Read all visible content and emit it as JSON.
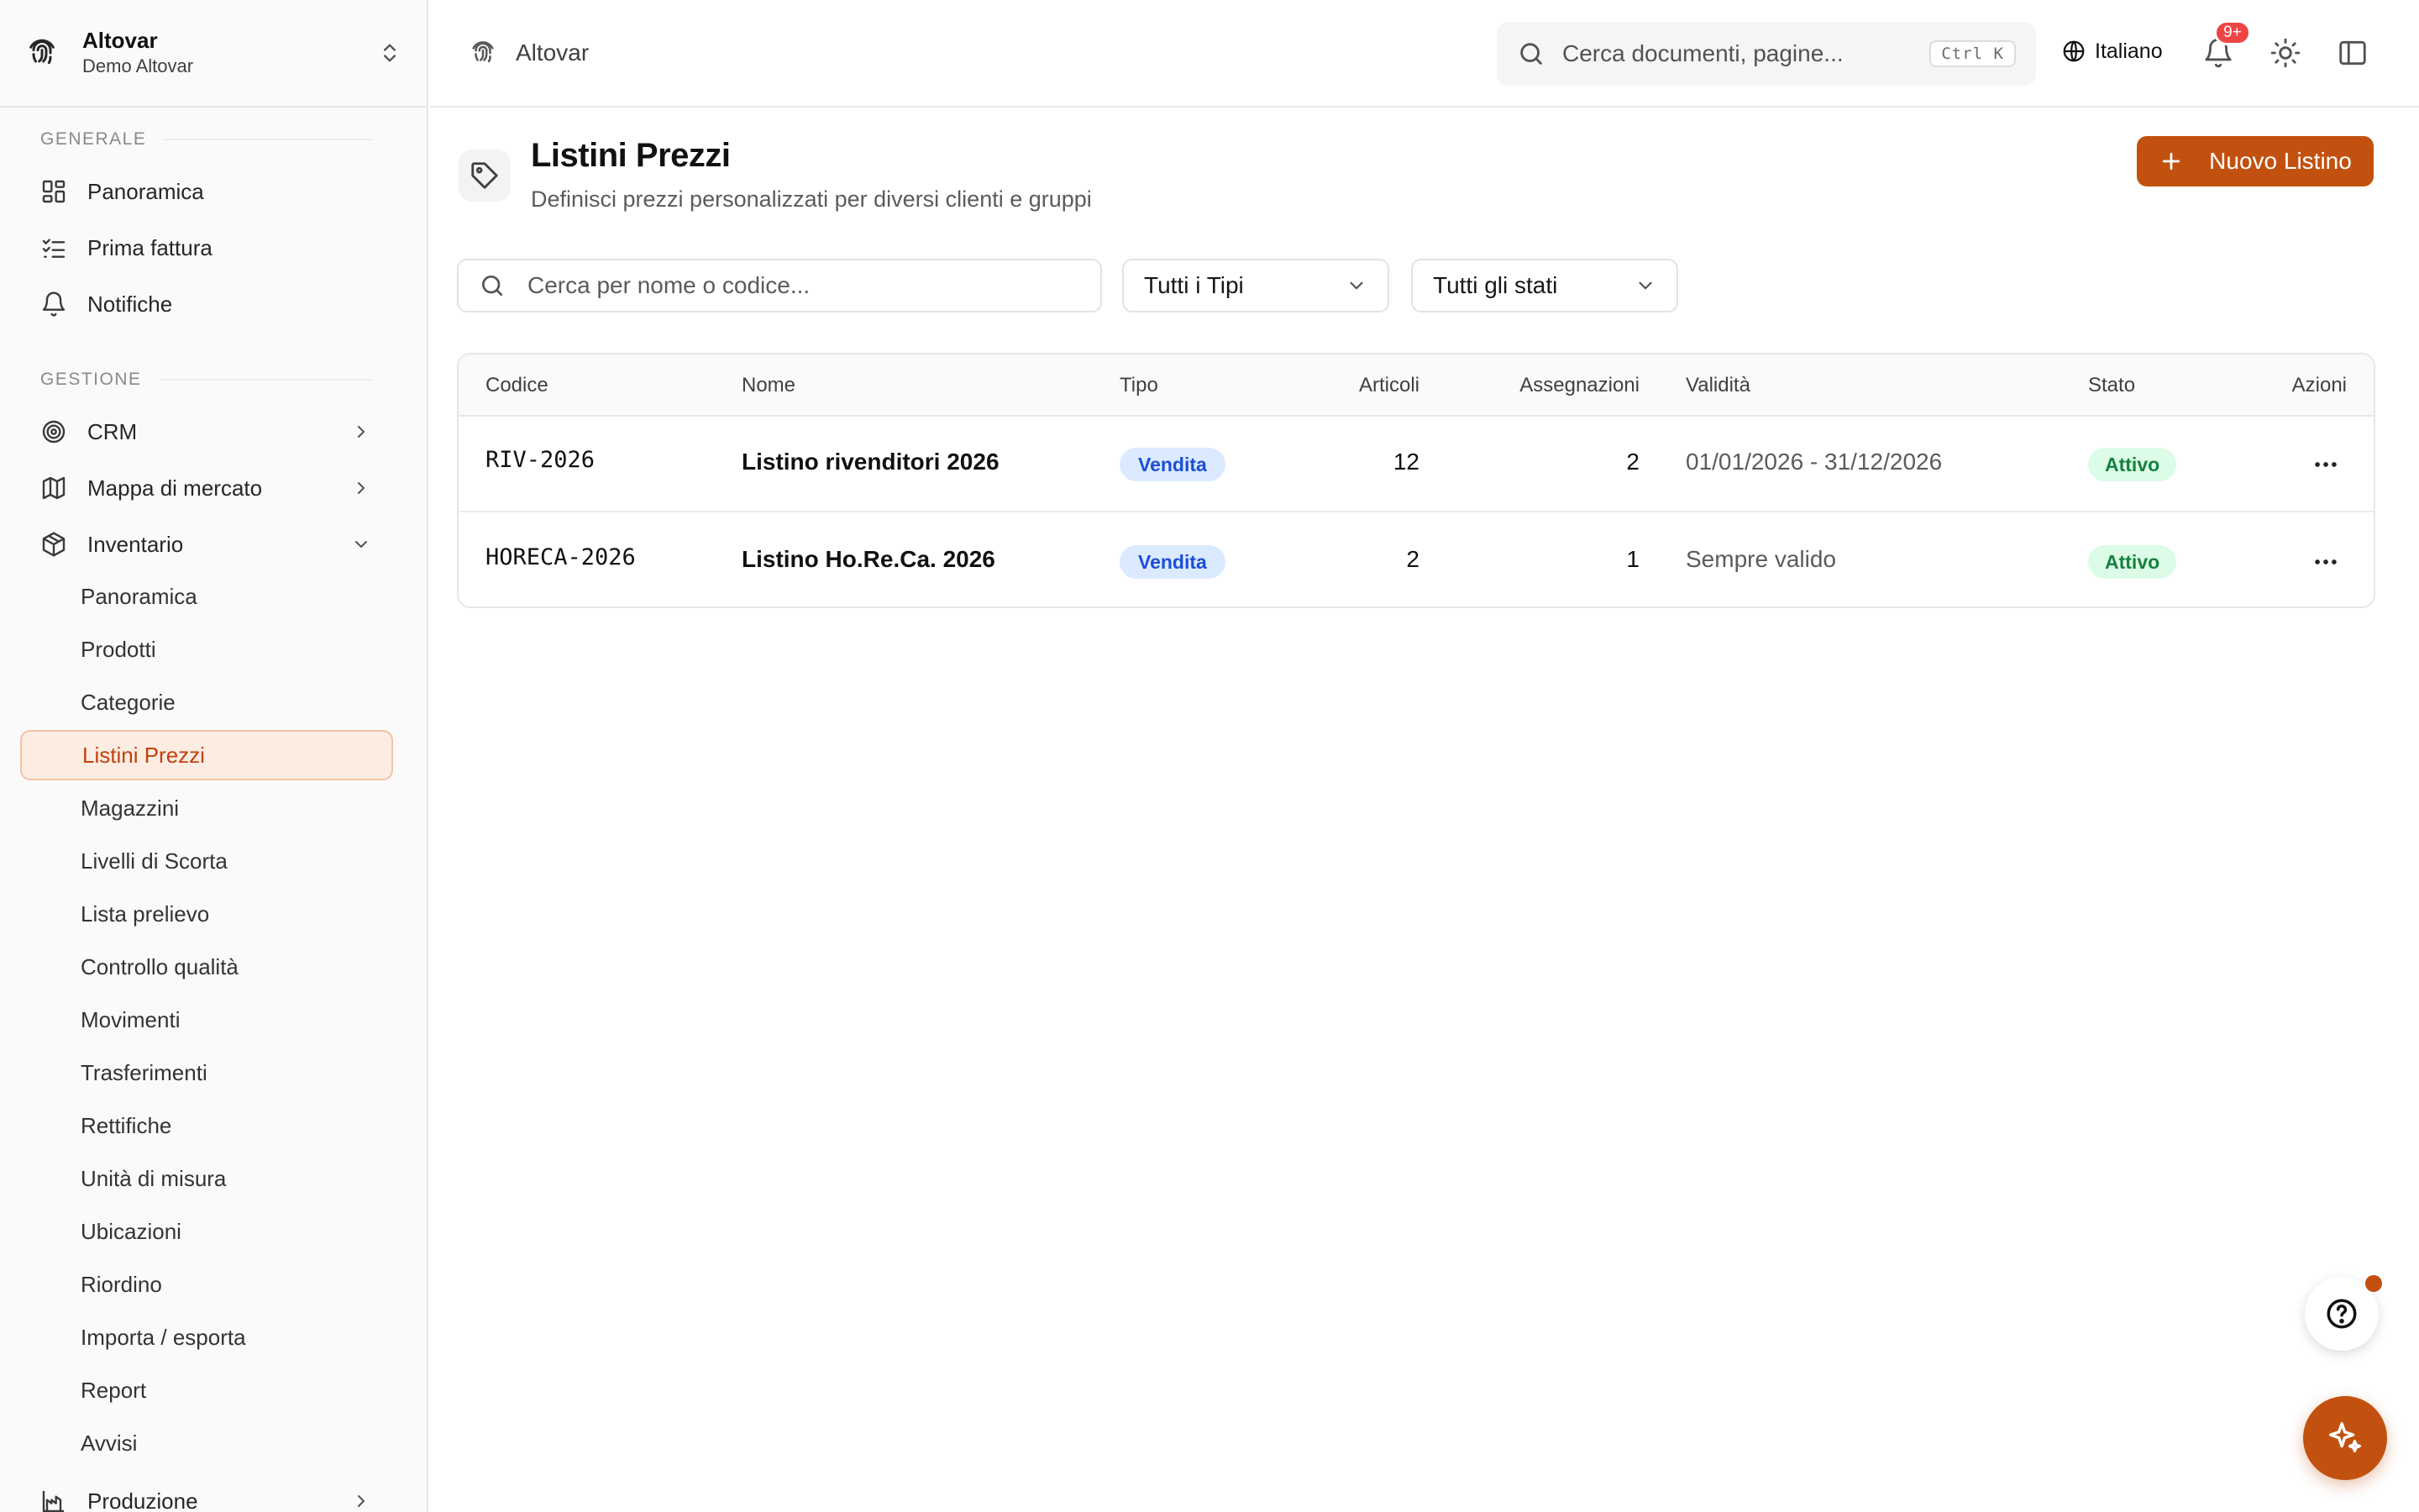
{
  "org": {
    "name": "Altovar",
    "subtitle": "Demo Altovar"
  },
  "sidebar": {
    "section_general": "GENERALE",
    "general_items": [
      {
        "label": "Panoramica",
        "icon": "dashboard-grid-icon"
      },
      {
        "label": "Prima fattura",
        "icon": "checklist-icon"
      },
      {
        "label": "Notifiche",
        "icon": "bell-icon"
      }
    ],
    "section_management": "GESTIONE",
    "management_items": [
      {
        "label": "CRM",
        "icon": "target-icon",
        "expanded": false
      },
      {
        "label": "Mappa di mercato",
        "icon": "map-icon",
        "expanded": false
      },
      {
        "label": "Inventario",
        "icon": "package-icon",
        "expanded": true
      }
    ],
    "inventory_subitems": [
      "Panoramica",
      "Prodotti",
      "Categorie",
      "Listini Prezzi",
      "Magazzini",
      "Livelli di Scorta",
      "Lista prelievo",
      "Controllo qualità",
      "Movimenti",
      "Trasferimenti",
      "Rettifiche",
      "Unità di misura",
      "Ubicazioni",
      "Riordino",
      "Importa / esporta",
      "Report",
      "Avvisi"
    ],
    "active_subitem": "Listini Prezzi",
    "production": {
      "label": "Produzione",
      "icon": "factory-chart-icon"
    }
  },
  "header": {
    "breadcrumb": "Altovar",
    "search_placeholder": "Cerca documenti, pagine...",
    "search_shortcut": "Ctrl K",
    "language": "Italiano",
    "notification_badge": "9+"
  },
  "page": {
    "title": "Listini Prezzi",
    "subtitle": "Definisci prezzi personalizzati per diversi clienti e gruppi",
    "new_button": "Nuovo Listino"
  },
  "filters": {
    "search_placeholder": "Cerca per nome o codice...",
    "type_select": "Tutti i Tipi",
    "status_select": "Tutti gli stati"
  },
  "table": {
    "columns": [
      "Codice",
      "Nome",
      "Tipo",
      "Articoli",
      "Assegnazioni",
      "Validità",
      "Stato",
      "Azioni"
    ],
    "rows": [
      {
        "code": "RIV-2026",
        "name": "Listino rivenditori 2026",
        "type": "Vendita",
        "items": "12",
        "assignments": "2",
        "validity": "01/01/2026 - 31/12/2026",
        "status": "Attivo"
      },
      {
        "code": "HORECA-2026",
        "name": "Listino Ho.Re.Ca. 2026",
        "type": "Vendita",
        "items": "2",
        "assignments": "1",
        "validity": "Sempre valido",
        "status": "Attivo"
      }
    ]
  },
  "colors": {
    "accent": "#c2510f",
    "type_pill": "#dbeafe",
    "status_pill": "#dcfce7",
    "badge": "#ef4444"
  }
}
